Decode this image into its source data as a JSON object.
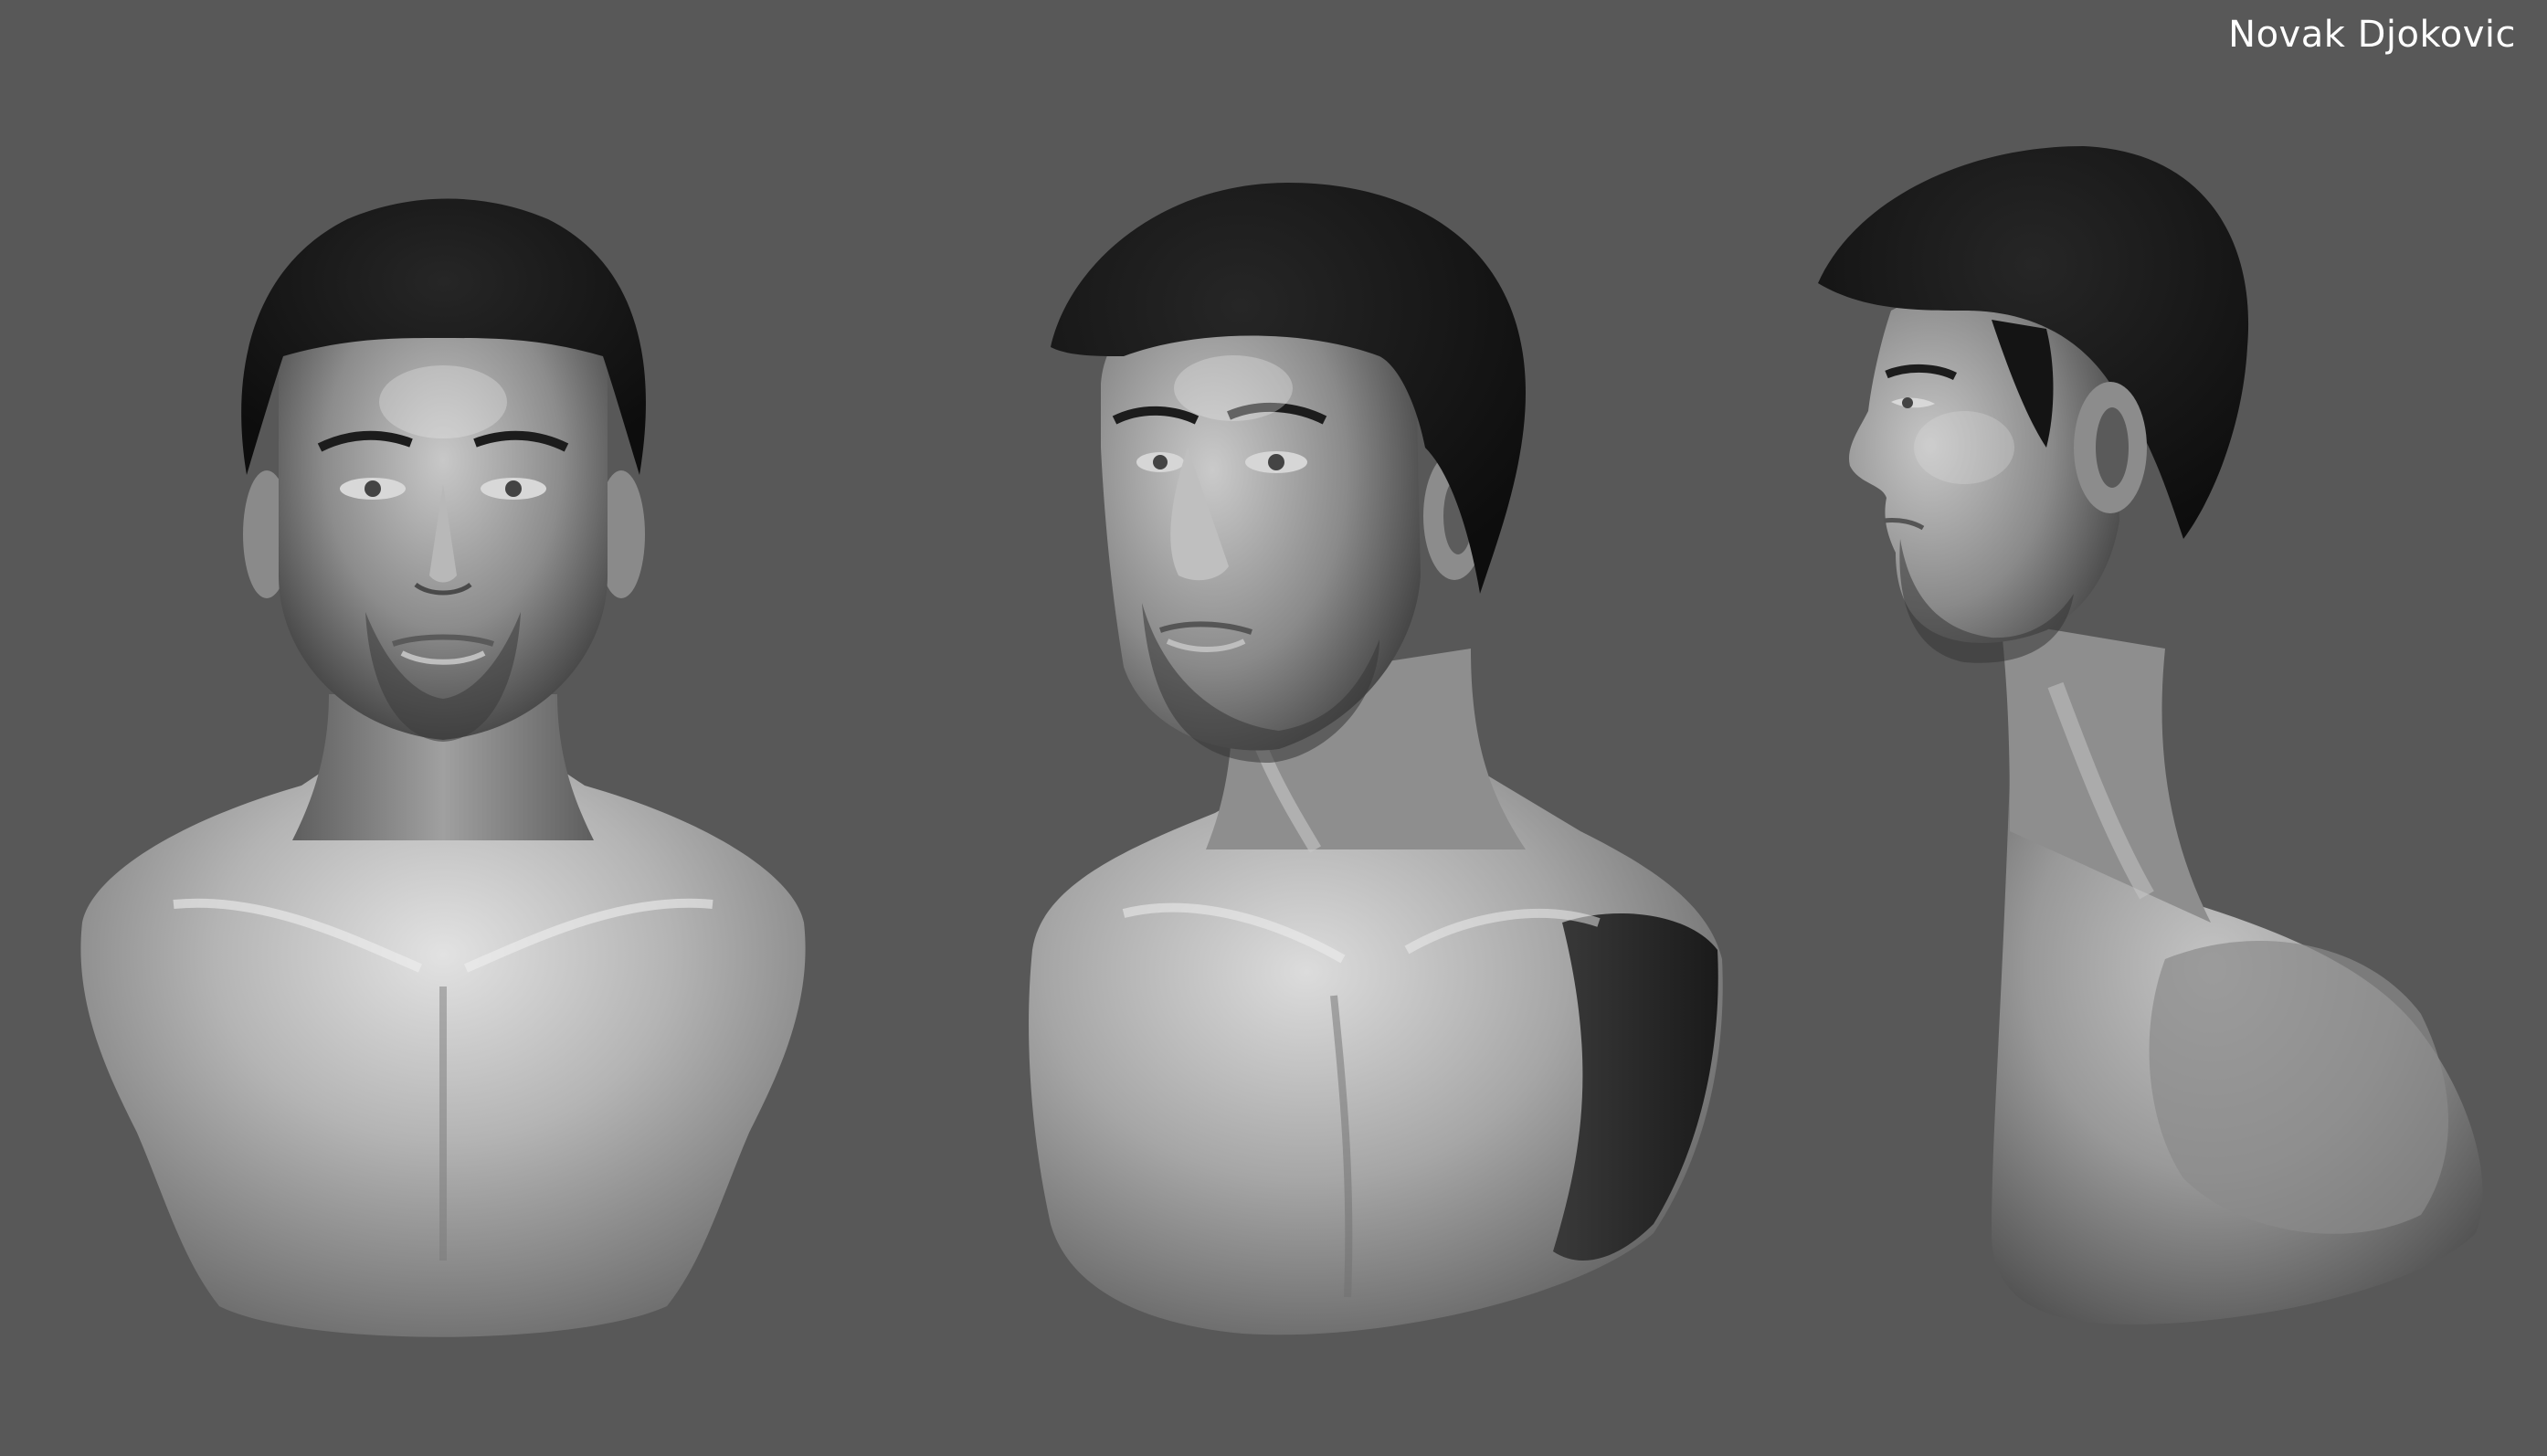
{
  "title": "Novak Djokovic",
  "views": [
    {
      "name": "front-view"
    },
    {
      "name": "three-quarter-view"
    },
    {
      "name": "profile-view"
    }
  ],
  "colors": {
    "background": "#585858",
    "skin": "#a8a8a8",
    "skin_highlight": "#e6e6e6",
    "skin_shadow": "#3c3c3c",
    "hair": "#151515",
    "title_text": "#ffffff"
  }
}
